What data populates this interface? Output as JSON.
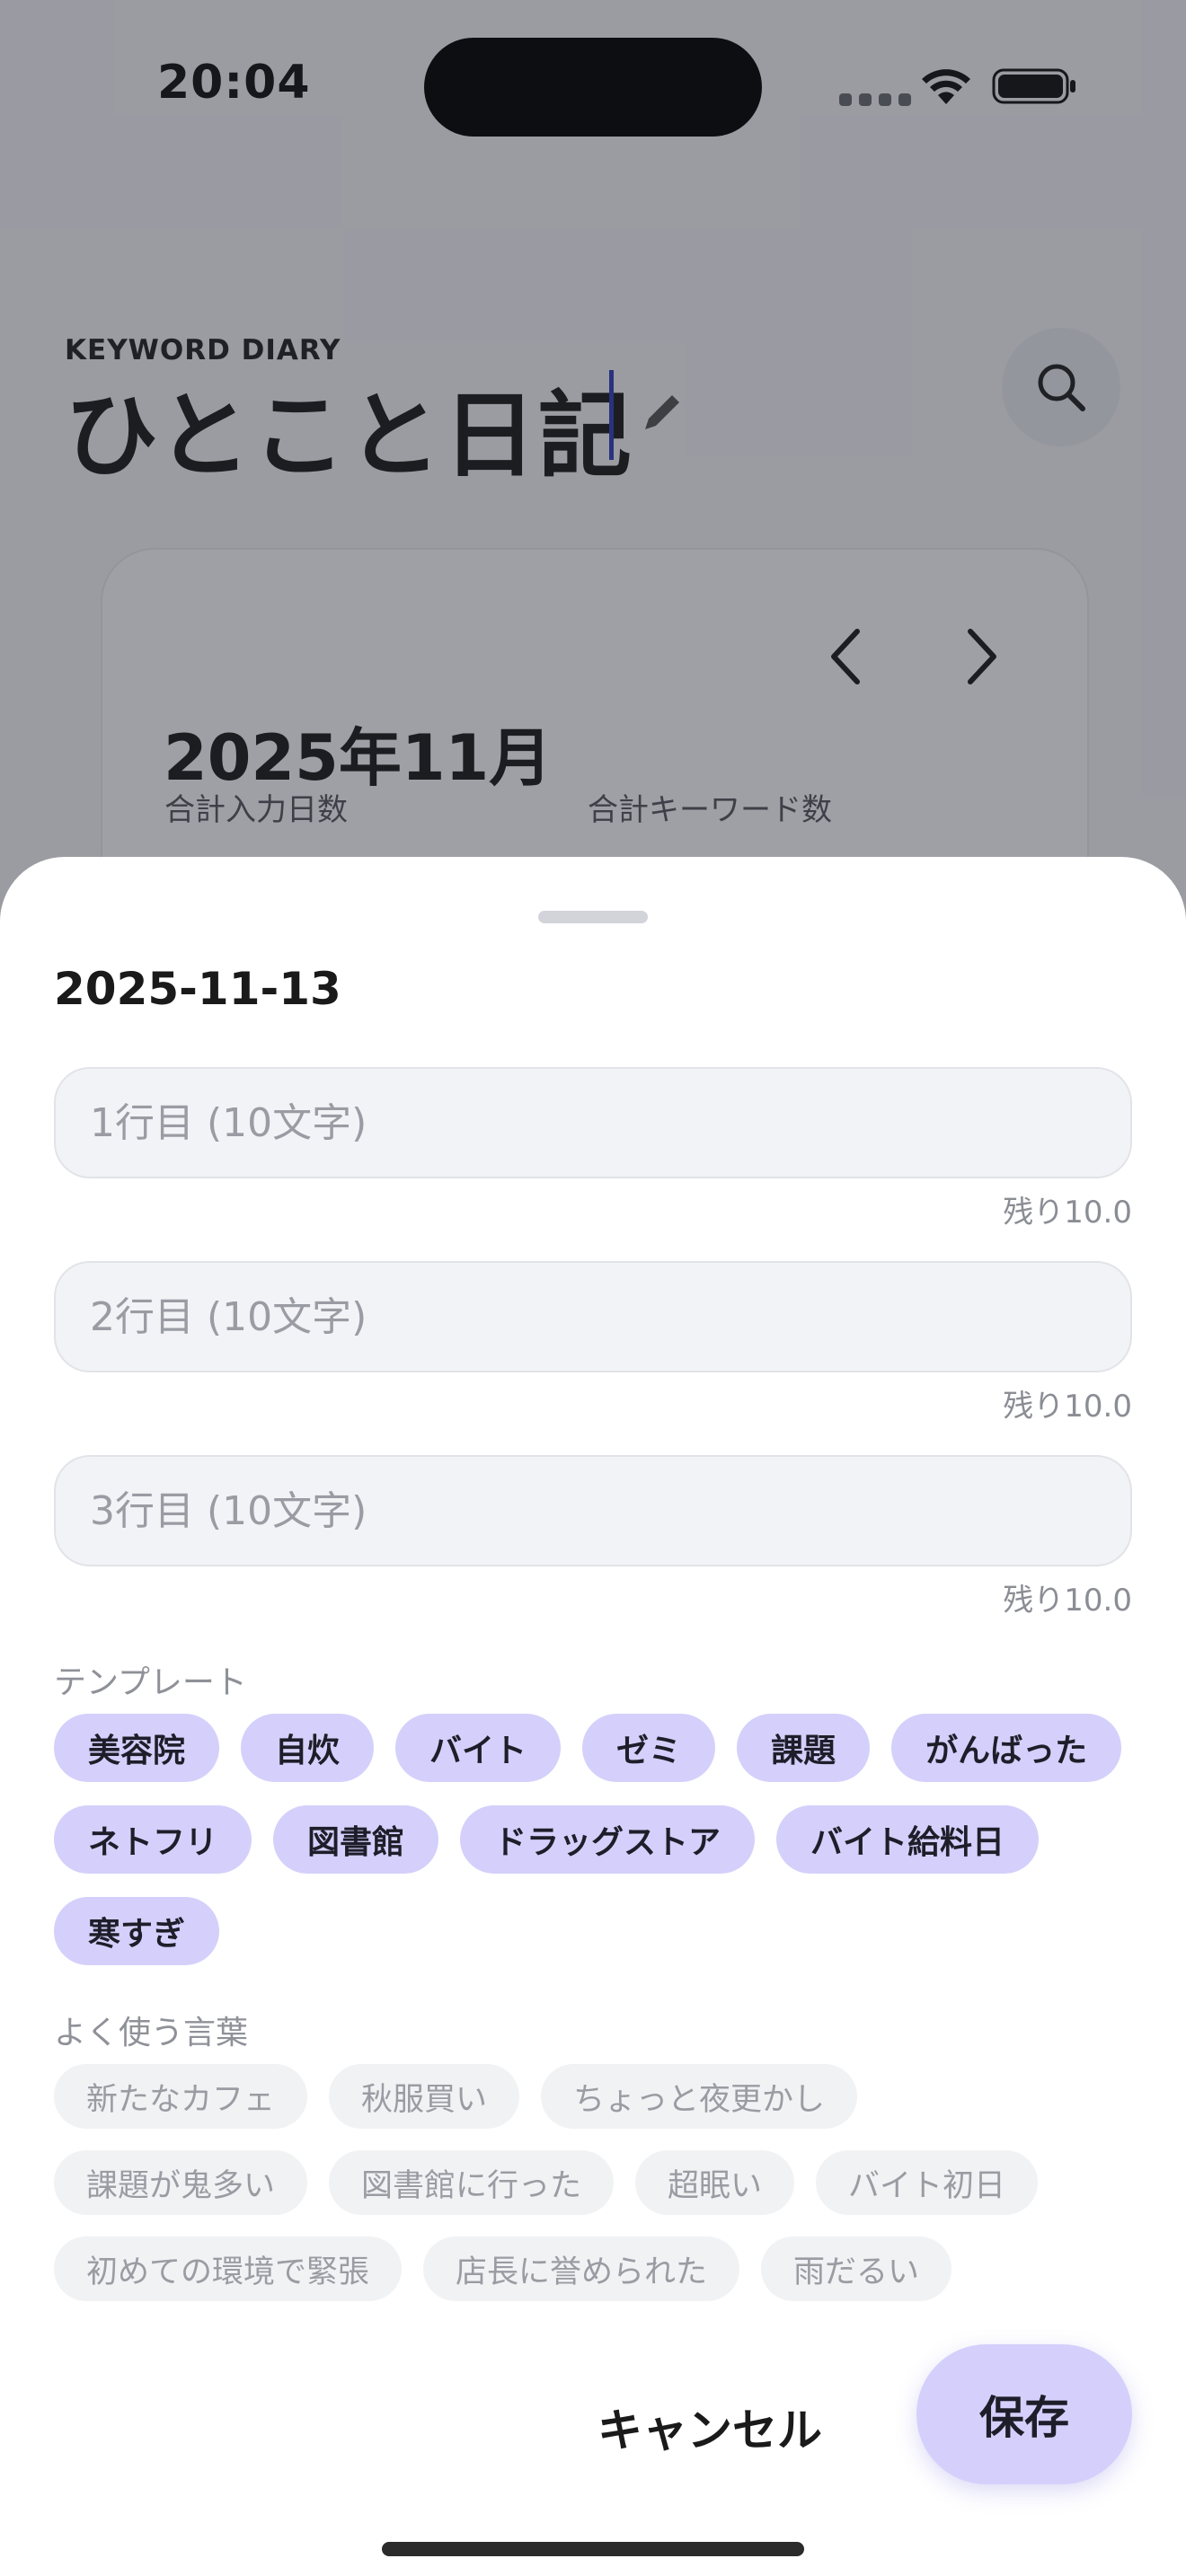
{
  "status_bar": {
    "time": "20:04"
  },
  "header": {
    "subtitle": "KEYWORD DIARY",
    "title": "ひとこと日記"
  },
  "calendar": {
    "month": "2025年11月",
    "stats": [
      "合計入力日数",
      "合計キーワード数"
    ]
  },
  "sheet": {
    "date": "2025-11-13",
    "inputs": [
      {
        "placeholder": "1行目 (10文字)",
        "value": "",
        "remaining": "残り10.0"
      },
      {
        "placeholder": "2行目 (10文字)",
        "value": "",
        "remaining": "残り10.0"
      },
      {
        "placeholder": "3行目 (10文字)",
        "value": "",
        "remaining": "残り10.0"
      }
    ],
    "templates_label": "テンプレート",
    "templates": [
      "美容院",
      "自炊",
      "バイト",
      "ゼミ",
      "課題",
      "がんばった",
      "ネトフリ",
      "図書館",
      "ドラッグストア",
      "バイト給料日",
      "寒すぎ"
    ],
    "frequent_label": "よく使う言葉",
    "frequent_words": [
      "新たなカフェ",
      "秋服買い",
      "ちょっと夜更かし",
      "課題が鬼多い",
      "図書館に行った",
      "超眠い",
      "バイト初日",
      "初めての環境で緊張",
      "店長に誉められた",
      "雨だるい"
    ],
    "cancel_label": "キャンセル",
    "save_label": "保存"
  },
  "colors": {
    "accent_chip": "#d4d0fb",
    "word_chip": "#f1f2f4",
    "caret": "#2f3fb8"
  },
  "icons": {
    "edit": "pencil-icon",
    "search": "search-icon",
    "prev": "chevron-left-icon",
    "next": "chevron-right-icon"
  }
}
